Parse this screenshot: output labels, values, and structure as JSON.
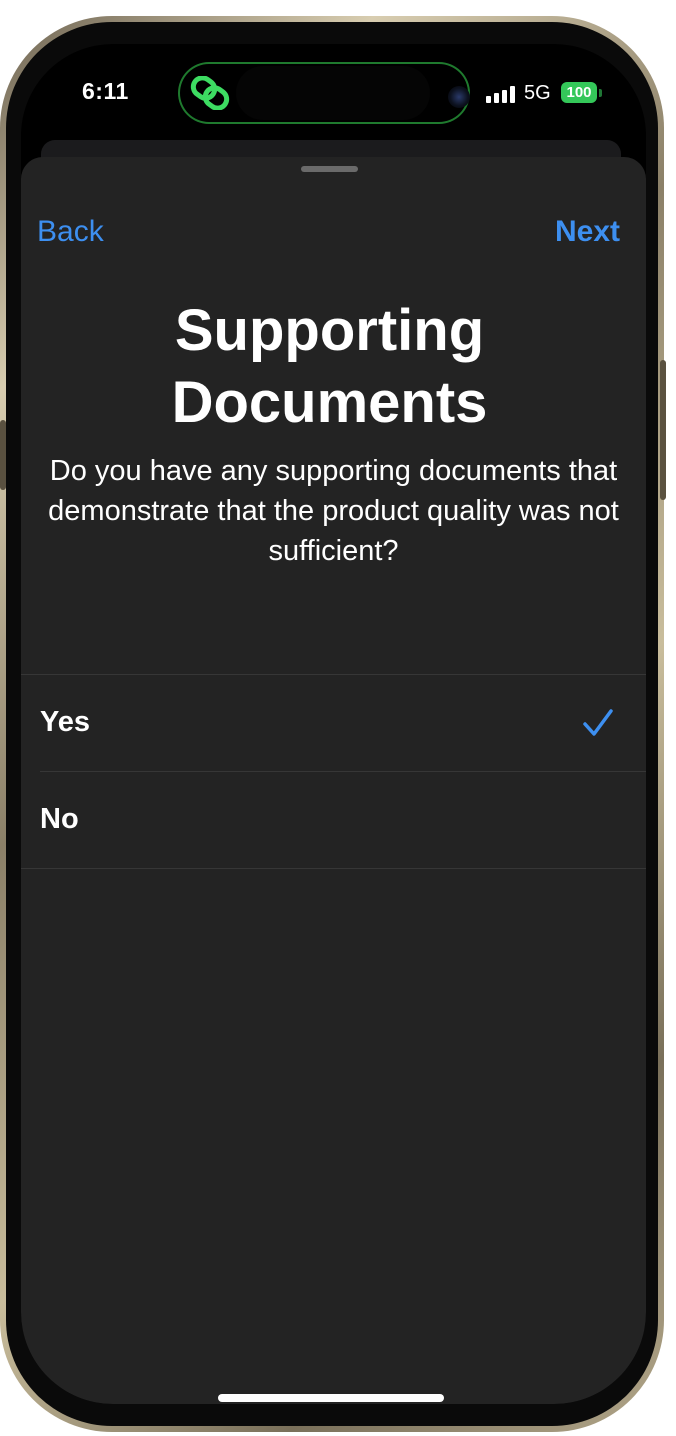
{
  "status_bar": {
    "time": "6:11",
    "network": "5G",
    "battery": "100"
  },
  "navigation": {
    "back_label": "Back",
    "next_label": "Next"
  },
  "page": {
    "title": "Supporting Documents",
    "question": "Do you have any supporting documents that demonstrate that the product quality was not sufficient?"
  },
  "options": [
    {
      "label": "Yes",
      "selected": true
    },
    {
      "label": "No",
      "selected": false
    }
  ],
  "colors": {
    "accent": "#3d8ff0",
    "sheet_background": "#232323",
    "battery": "#34c759",
    "island_glow": "#1f7a2e"
  },
  "icons": {
    "live_activity": "link-icon",
    "selected_marker": "checkmark-icon",
    "signal": "signal-bars-icon",
    "battery": "battery-icon"
  }
}
